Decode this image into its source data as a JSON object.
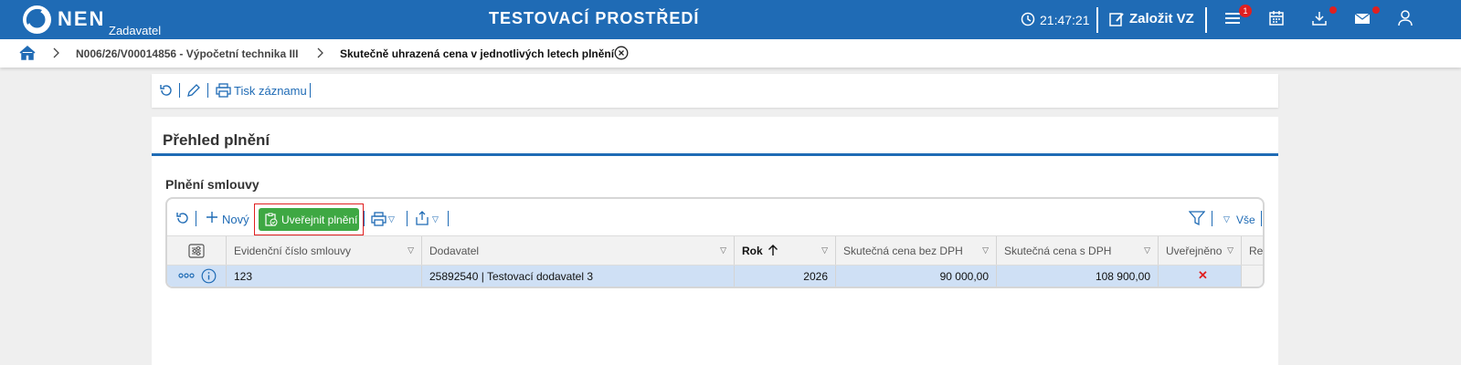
{
  "header": {
    "brand": "NEN",
    "role": "Zadavatel",
    "environment": "TESTOVACÍ PROSTŘEDÍ",
    "clock": "21:47:21",
    "create_label": "Založit VZ",
    "menu_badge": "1",
    "icons": [
      "logo-icon",
      "clock-icon",
      "create-icon",
      "menu-icon",
      "calendar-icon",
      "download-icon",
      "mail-icon",
      "user-icon"
    ],
    "accent_color": "#1f6bb5",
    "badge_color": "#e02020"
  },
  "breadcrumb": {
    "items": [
      "N006/26/V00014856 - Výpočetní technika III",
      "Skutečně uhrazená cena v jednotlivých letech plnění"
    ]
  },
  "record_toolbar": {
    "print_label": "Tisk záznamu"
  },
  "main": {
    "title": "Přehled plnění",
    "section_title": "Plnění smlouvy",
    "toolbar": {
      "new_label": "Nový",
      "publish_label": "Uveřejnit plnění",
      "all_label": "Vše",
      "publish_color": "#3ea843"
    },
    "table": {
      "columns": [
        "Evidenční číslo smlouvy",
        "Dodavatel",
        "Rok",
        "Skutečná cena bez DPH",
        "Skutečná cena s DPH",
        "Uveřejněno",
        "Re"
      ],
      "sort_column": "Rok",
      "sort_direction": "ascending",
      "rows": [
        {
          "evidencni_cislo": "123",
          "dodavatel": "25892540 | Testovací dodavatel 3",
          "rok": "2026",
          "cena_bez_dph": "90 000,00",
          "cena_s_dph": "108 900,00",
          "uverejneno": "✕"
        }
      ]
    }
  }
}
